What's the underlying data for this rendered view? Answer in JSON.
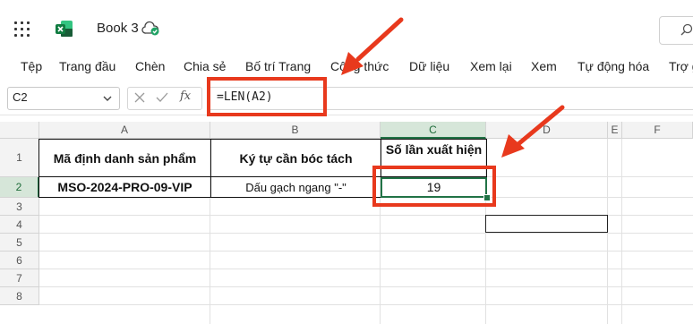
{
  "app": {
    "book_title": "Book 3",
    "icons": [
      "waffle-icon",
      "excel-logo-icon",
      "cloud-saved-icon",
      "search-icon"
    ]
  },
  "ribbon": {
    "tabs": [
      "Tệp",
      "Trang đầu",
      "Chèn",
      "Chia sẻ",
      "Bố trí Trang",
      "Công thức",
      "Dữ liệu",
      "Xem lại",
      "Xem",
      "Tự động hóa",
      "Trợ g"
    ]
  },
  "formula_bar": {
    "name_box": "C2",
    "fx_label": "fx",
    "formula": "=LEN(A2)"
  },
  "grid": {
    "columns": [
      "A",
      "B",
      "C",
      "D",
      "E",
      "F"
    ],
    "rows": [
      "1",
      "2",
      "3",
      "4",
      "5",
      "6",
      "7",
      "8"
    ],
    "selected_cell": "C2",
    "cells": {
      "A1": "Mã định danh sản phẩm",
      "B1": "Ký tự cần bóc tách",
      "C1": "Số lần xuất hiện",
      "A2": "MSO-2024-PRO-09-VIP",
      "B2": "Dấu gạch ngang \"-\"",
      "C2": "19"
    }
  },
  "colors": {
    "accent_green": "#217346",
    "annotation_red": "#e8391d"
  }
}
